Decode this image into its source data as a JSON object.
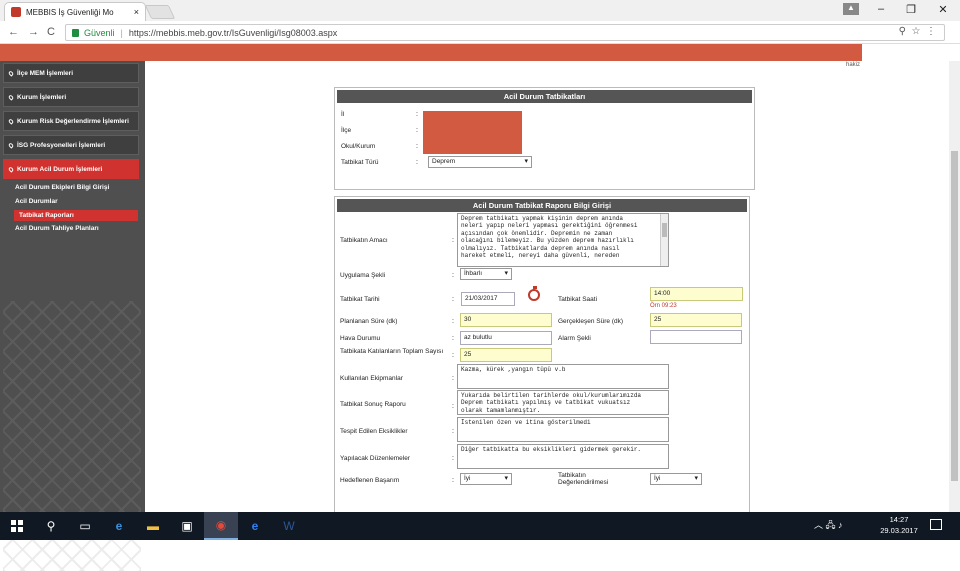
{
  "browser": {
    "tab_title": "MEBBIS İş Güvenliği Mo",
    "close": "×",
    "secure_label": "Güvenli",
    "url": "https://mebbis.meb.gov.tr/IsGuvenligi/Isg08003.aspx",
    "back": "←",
    "forward": "→",
    "reload": "C",
    "search_icon": "⚲",
    "star_icon": "☆",
    "menu_icon": "⋮",
    "minimize": "–",
    "maximize": "❐",
    "close_window": "✕"
  },
  "sidebar": {
    "items": [
      {
        "label": "İlçe MEM İşlemleri"
      },
      {
        "label": "Kurum İşlemleri"
      },
      {
        "label": "Kurum Risk Değerlendirme İşlemleri"
      },
      {
        "label": "İSG Profesyonelleri İşlemleri"
      },
      {
        "label": "Kurum Acil Durum İşlemleri"
      }
    ],
    "subitems": [
      {
        "label": "Acil Durum Ekipleri Bilgi Girişi"
      },
      {
        "label": "Acil Durumlar"
      },
      {
        "label": "Tatbikat Raporları"
      },
      {
        "label": "Acil Durum Tahliye Planları"
      }
    ]
  },
  "panel1": {
    "title": "Acil Durum Tatbikatları",
    "il_label": "İl",
    "ilce_label": "İlçe",
    "okul_label": "Okul/Kurum",
    "tur_label": "Tatbikat Türü",
    "tur_value": "Deprem"
  },
  "panel2": {
    "title": "Acil Durum Tatbikat Raporu Bilgi Girişi",
    "amac_label": "Tatbikatın Amacı",
    "amac_value": "Deprem tatbikatı yapmak kişinin deprem anında\nneleri yapıp neleri yapması gerektiğini öğrenmesi\naçısından çok önemlidir. Depremin ne zaman\nolacağını bilemeyiz. Bu yüzden deprem hazırlıklı\nolmalıyız. Tatbikatlarda deprem anında nasıl\nhareket etmeli, nereyi daha güvenli, nereden",
    "sekil_label": "Uygulama Şekli",
    "sekil_value": "İhbarlı",
    "tarih_label": "Tatbikat Tarihi",
    "tarih_value": "21/03/2017",
    "saat_label": "Tatbikat Saati",
    "saat_value": "14:00",
    "saat_hint": "Örn 09:23",
    "plan_label": "Planlanan Süre (dk)",
    "plan_value": "30",
    "gercek_label": "Gerçekleşen Süre (dk)",
    "gercek_value": "25",
    "hava_label": "Hava Durumu",
    "hava_value": "az bulutlu",
    "alarm_label": "Alarm Şekli",
    "alarm_value": "",
    "kisi_label": "Tatbikata Katılanların Toplam Sayısı",
    "kisi_value": "25",
    "ekip_label": "Kullanılan Ekipmanlar",
    "ekip_value": "Kazma, kürek ,yangın tüpü v.b",
    "rapor_label": "Tatbikat Sonuç Raporu",
    "rapor_value": "Yukarıda belirtilen tarihlerde okul/kurumlarımızda\nDeprem tatbikatı yapılmış ve tatbikat vukuatsız\nolarak tamamlanmıştır.",
    "eksik_label": "Tespit Edilen Eksiklikler",
    "eksik_value": "İstenilen özen ve itina gösterilmedi",
    "duzen_label": "Yapılacak Düzenlemeler",
    "duzen_value": "Diğer tatbikatta bu eksiklikleri gidermek gerekir.",
    "hedef_label": "Hedeflenen Başarım",
    "hedef_value": "İyi",
    "deger_label": "Tatbikatın Değerlendirilmesi",
    "deger_value": "İyi"
  },
  "colon": ":",
  "corner_text": "hakiz",
  "taskbar": {
    "time": "14:27",
    "date": "29.03.2017",
    "tray_icons": "︿ 🖧 ♪"
  }
}
